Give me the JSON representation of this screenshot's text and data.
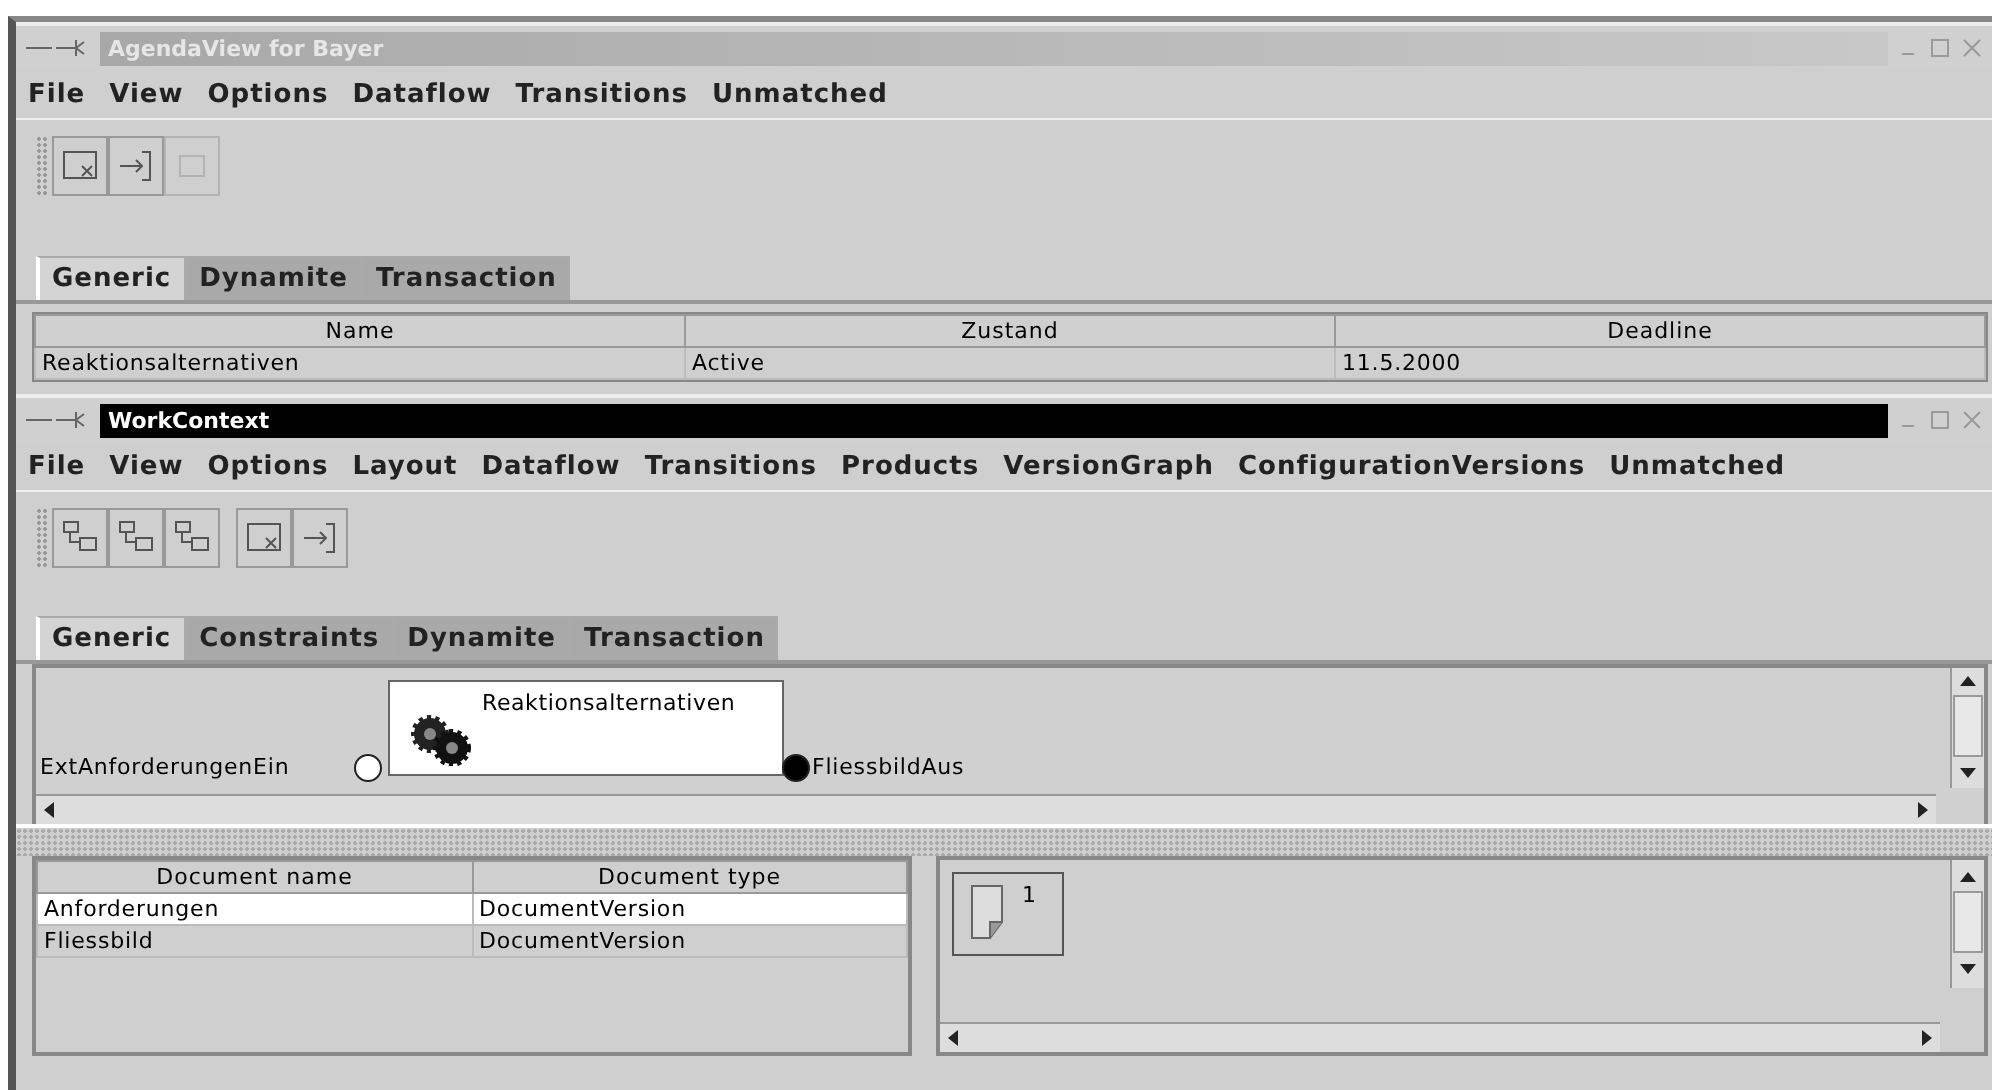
{
  "windows": [
    {
      "title": "AgendaView for Bayer",
      "active": false,
      "menu": [
        "File",
        "View",
        "Options",
        "Dataflow",
        "Transitions",
        "Unmatched"
      ],
      "toolbar": [
        {
          "kind": "close-view",
          "disabled": false
        },
        {
          "kind": "exit",
          "disabled": false
        },
        {
          "kind": "blank",
          "disabled": true
        }
      ],
      "tabs": [
        {
          "label": "Generic",
          "selected": true
        },
        {
          "label": "Dynamite",
          "selected": false
        },
        {
          "label": "Transaction",
          "selected": false
        }
      ],
      "table": {
        "columns": [
          "Name",
          "Zustand",
          "Deadline"
        ],
        "rows": [
          {
            "cells": [
              "Reaktionsalternativen",
              "Active",
              "11.5.2000"
            ]
          }
        ]
      }
    },
    {
      "title": "WorkContext",
      "active": true,
      "menu": [
        "File",
        "View",
        "Options",
        "Layout",
        "Dataflow",
        "Transitions",
        "Products",
        "VersionGraph",
        "ConfigurationVersions",
        "Unmatched"
      ],
      "toolbar": [
        {
          "kind": "process",
          "disabled": false
        },
        {
          "kind": "process",
          "disabled": false
        },
        {
          "kind": "process",
          "disabled": false
        },
        {
          "kind": "separator"
        },
        {
          "kind": "close-view",
          "disabled": false
        },
        {
          "kind": "exit",
          "disabled": false
        }
      ],
      "tabs": [
        {
          "label": "Generic",
          "selected": true
        },
        {
          "label": "Constraints",
          "selected": false
        },
        {
          "label": "Dynamite",
          "selected": false
        },
        {
          "label": "Transaction",
          "selected": false
        }
      ],
      "diagram": {
        "node": {
          "label": "Reaktionsalternativen"
        },
        "ports": [
          {
            "kind": "input",
            "label": "ExtAnforderungenEin"
          },
          {
            "kind": "output",
            "label": "FliessbildAus"
          }
        ]
      },
      "documents": {
        "columns": [
          "Document name",
          "Document type"
        ],
        "rows": [
          {
            "cells": [
              "Anforderungen",
              "DocumentVersion"
            ],
            "selected": true
          },
          {
            "cells": [
              "Fliessbild",
              "DocumentVersion"
            ],
            "selected": false
          }
        ]
      },
      "versions": [
        {
          "label": "1"
        }
      ]
    }
  ]
}
